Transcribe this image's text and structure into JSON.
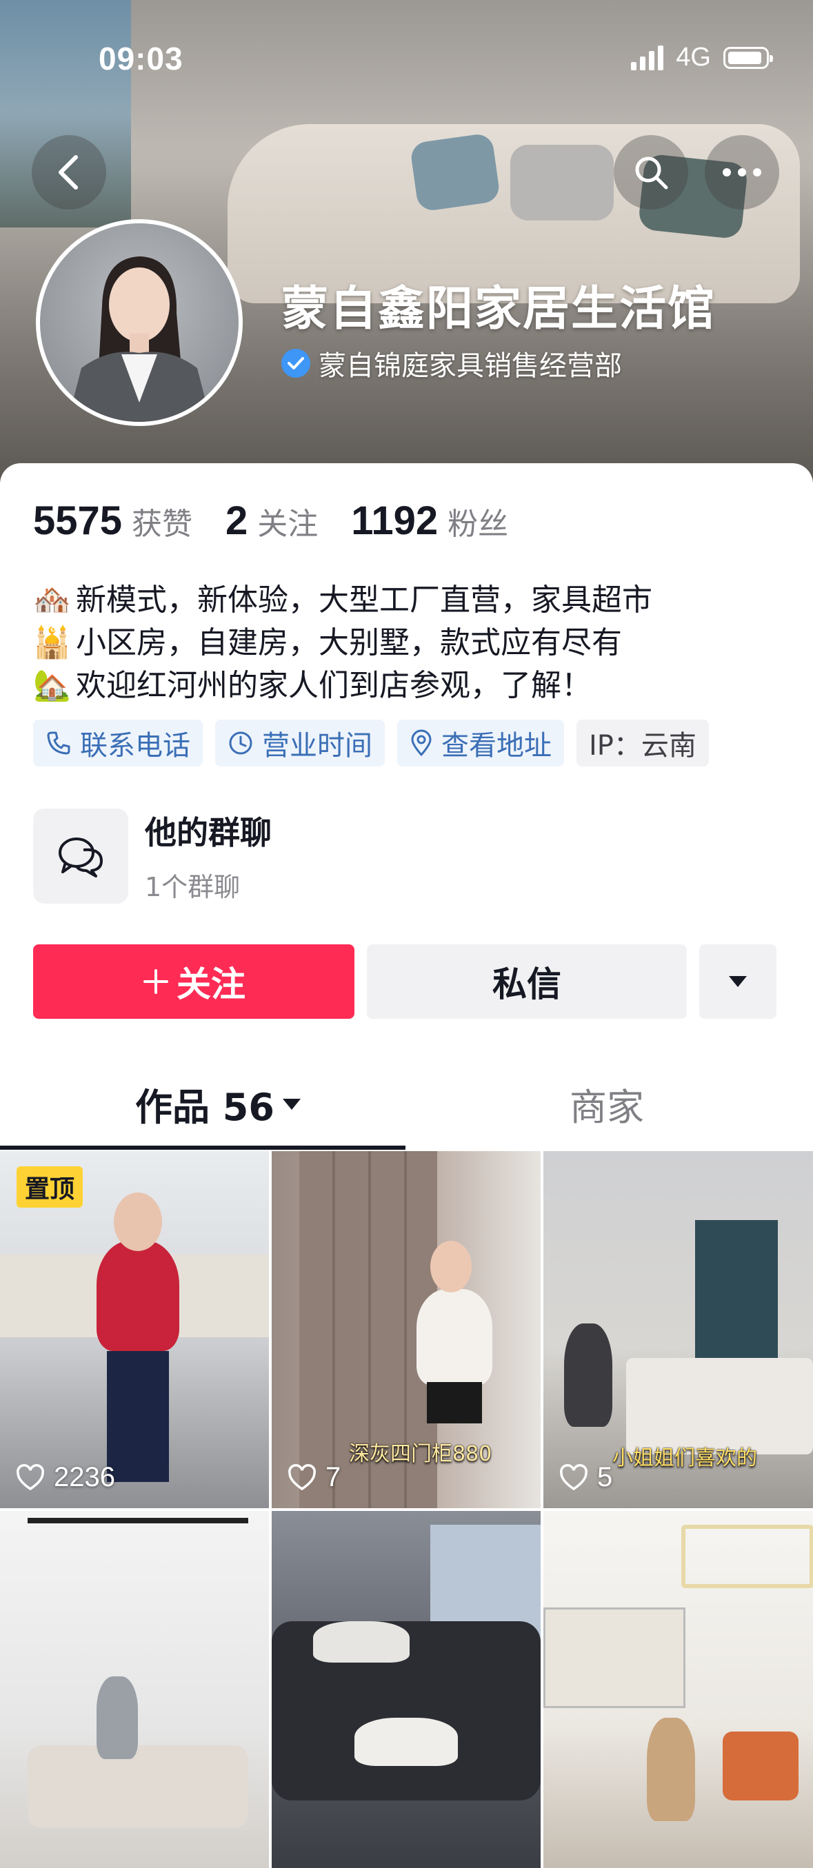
{
  "status_bar": {
    "time": "09:03",
    "network": "4G"
  },
  "profile": {
    "name": "蒙自鑫阳家居生活馆",
    "verified_label": "蒙自锦庭家具销售经营部",
    "stats": [
      {
        "value": "5575",
        "label": "获赞"
      },
      {
        "value": "2",
        "label": "关注"
      },
      {
        "value": "1192",
        "label": "粉丝"
      }
    ],
    "bio": [
      {
        "emoji": "🏘️",
        "text": "新模式，新体验，大型工厂直营，家具超市"
      },
      {
        "emoji": "🕌",
        "text": "小区房，自建房，大别墅，款式应有尽有"
      },
      {
        "emoji": "🏡",
        "text": "欢迎红河州的家人们到店参观，了解！"
      }
    ],
    "tags": [
      {
        "label": "联系电话",
        "icon": "phone-icon"
      },
      {
        "label": "营业时间",
        "icon": "clock-icon"
      },
      {
        "label": "查看地址",
        "icon": "location-pin-icon"
      },
      {
        "label": "IP：云南",
        "icon": ""
      }
    ]
  },
  "group_chat": {
    "title": "他的群聊",
    "subtitle": "1个群聊"
  },
  "actions": {
    "follow": "关注",
    "message": "私信"
  },
  "tabs": {
    "works": "作品 56",
    "merchant": "商家"
  },
  "videos": [
    {
      "likes": "2236",
      "pinned": "置顶",
      "caption": ""
    },
    {
      "likes": "7",
      "pinned": "",
      "caption": "深灰四门柜880"
    },
    {
      "likes": "5",
      "pinned": "",
      "caption": "小姐姐们喜欢的"
    },
    {
      "likes": "",
      "pinned": "",
      "caption": ""
    },
    {
      "likes": "",
      "pinned": "",
      "caption": ""
    },
    {
      "likes": "",
      "pinned": "",
      "caption": ""
    }
  ],
  "colors": {
    "follow_red": "#fe2c55",
    "tag_blue": "#3b6fb6",
    "verify_blue": "#3e96f6",
    "pin_yellow": "#fed234"
  }
}
